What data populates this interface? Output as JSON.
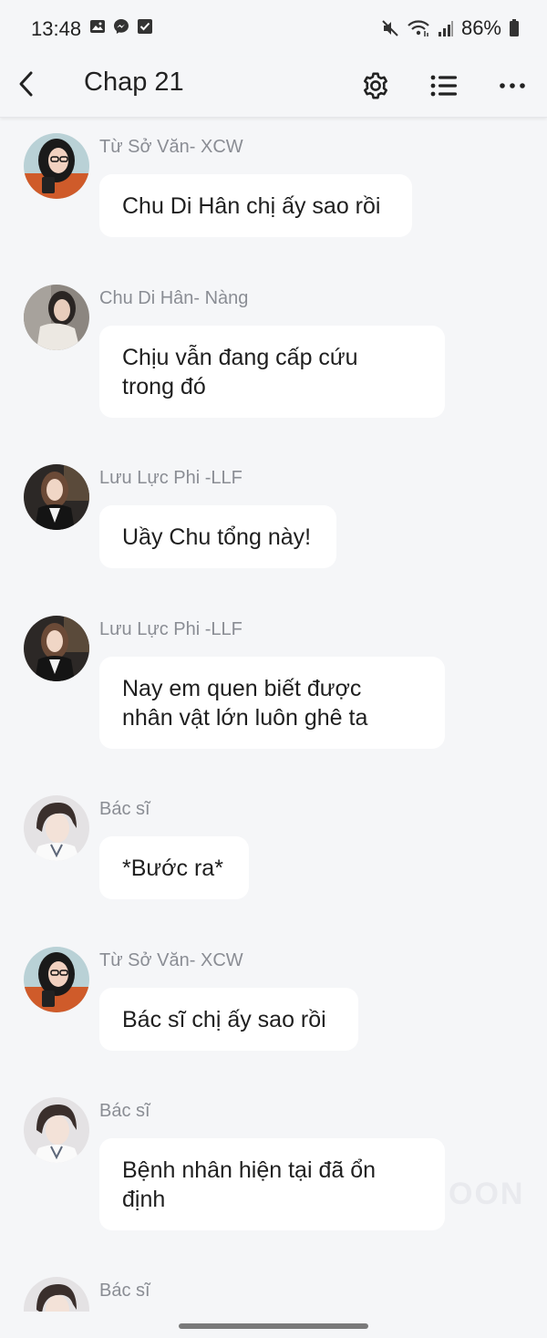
{
  "status": {
    "time": "13:48",
    "battery": "86%",
    "left_icons": [
      "gallery-icon",
      "messenger-icon",
      "checkbox-icon"
    ],
    "right_icons": [
      "mute-icon",
      "wifi-icon",
      "signal-icon",
      "battery-icon"
    ]
  },
  "header": {
    "title": "Chap 21",
    "icons": [
      "back-arrow-icon",
      "gear-icon",
      "list-icon",
      "more-icon"
    ]
  },
  "messages": [
    {
      "sender": "Từ Sở Văn- XCW",
      "line1": "Chu Di Hân chị ấy sao rồi",
      "line2": "",
      "avatar": "avatar-xcw"
    },
    {
      "sender": "Chu Di Hân- Nàng",
      "line1": "Chịu vẫn đang cấp cứu",
      "line2": "trong đó",
      "avatar": "avatar-nang"
    },
    {
      "sender": "Lưu Lực Phi -LLF",
      "line1": "Uầy Chu tổng này!",
      "line2": "",
      "avatar": "avatar-llf"
    },
    {
      "sender": "Lưu Lực Phi -LLF",
      "line1": "Nay em quen biết được",
      "line2": "nhân vật lớn luôn ghê ta",
      "avatar": "avatar-llf"
    },
    {
      "sender": "Bác sĩ",
      "line1": "*Bước ra*",
      "line2": "",
      "avatar": "avatar-doctor"
    },
    {
      "sender": "Từ Sở Văn- XCW",
      "line1": "Bác sĩ chị ấy sao rồi",
      "line2": "",
      "avatar": "avatar-xcw"
    },
    {
      "sender": "Bác sĩ",
      "line1": "Bệnh nhân hiện tại đã ổn",
      "line2": "định",
      "avatar": "avatar-doctor"
    },
    {
      "sender": "Bác sĩ",
      "line1": "",
      "line2": "",
      "avatar": "avatar-doctor"
    }
  ],
  "watermark": "OON",
  "colors": {
    "background": "#f5f6f8",
    "bubble": "#ffffff",
    "sender_text": "#8a8d94",
    "message_text": "#1f1f1f"
  }
}
